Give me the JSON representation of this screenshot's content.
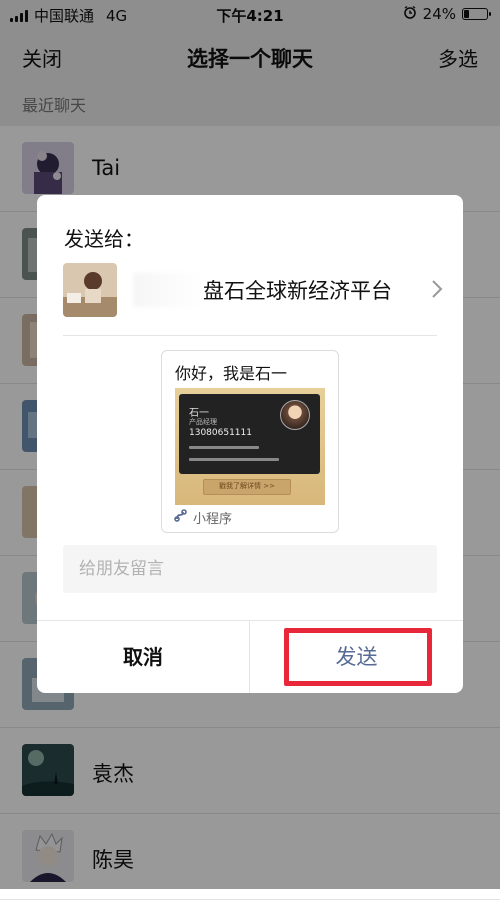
{
  "status_bar": {
    "carrier": "中国联通",
    "network": "4G",
    "time": "下午4:21",
    "battery_text": "24%",
    "battery_level": 0.24
  },
  "nav": {
    "close_label": "关闭",
    "title": "选择一个聊天",
    "multi_select_label": "多选"
  },
  "list": {
    "section_header": "最近聊天",
    "contacts": [
      {
        "name": "Tai"
      },
      {
        "name": ""
      },
      {
        "name": ""
      },
      {
        "name": ""
      },
      {
        "name": ""
      },
      {
        "name": ""
      },
      {
        "name": ""
      },
      {
        "name": "袁杰"
      },
      {
        "name": "陈昊"
      }
    ]
  },
  "dialog": {
    "title": "发送给：",
    "recipient_name": "盘石全球新经济平台",
    "card": {
      "title": "你好，我是石一",
      "bizcard_name": "石一",
      "bizcard_role": "产品经理",
      "bizcard_phone": "13080651111",
      "bizcard_button": "戳我了解详情 >>",
      "footer_label": "小程序"
    },
    "message_placeholder": "给朋友留言",
    "cancel_label": "取消",
    "send_label": "发送"
  },
  "colors": {
    "send_accent": "#576b95",
    "highlight": "#e8283a",
    "overlay": "rgba(0,0,0,0.40)"
  }
}
